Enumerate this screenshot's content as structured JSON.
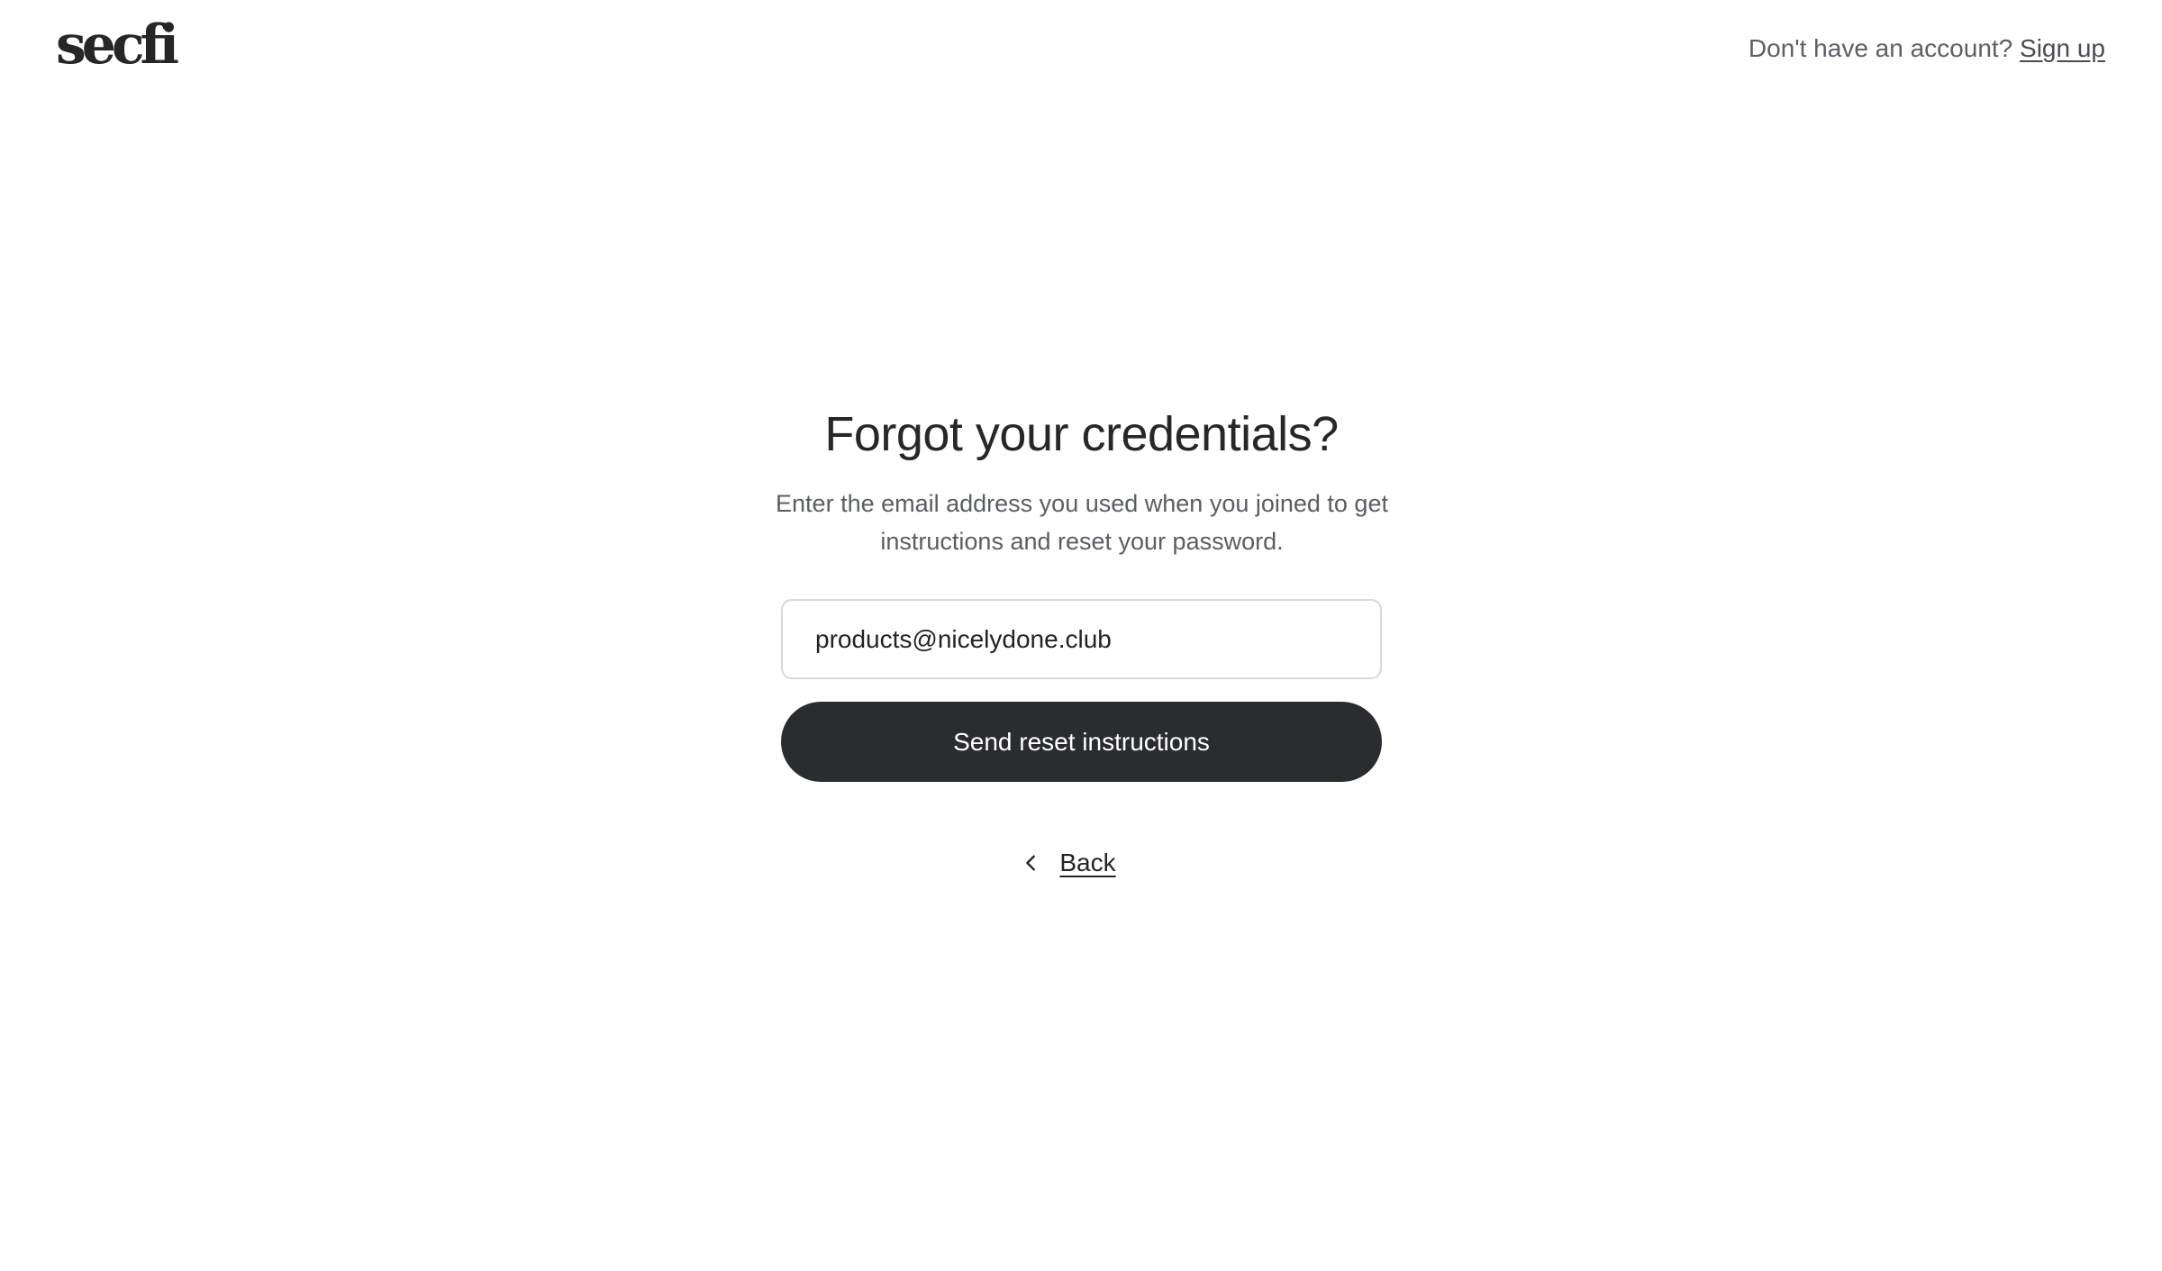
{
  "header": {
    "logo_text": "secfi",
    "account_prompt": "Don't have an account?",
    "signup_label": "Sign up"
  },
  "form": {
    "title": "Forgot your credentials?",
    "subtitle": "Enter the email address you used when you joined to get instructions and reset your password.",
    "email_value": "products@nicelydone.club",
    "submit_label": "Send reset instructions",
    "back_label": "Back"
  },
  "icons": {
    "back": "chevron-left-icon"
  },
  "colors": {
    "button_bg": "#2b2c2f",
    "text_primary": "#262728",
    "text_muted": "#5a5d63",
    "field_border": "#d7d8db"
  }
}
